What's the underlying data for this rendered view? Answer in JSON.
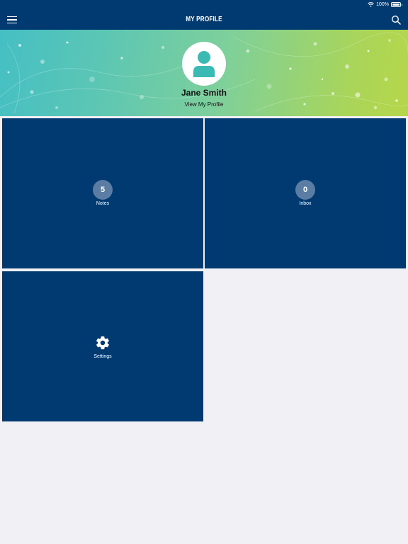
{
  "status_bar": {
    "battery_text": "100%"
  },
  "nav": {
    "title": "MY PROFILE"
  },
  "profile": {
    "name": "Jane Smith",
    "view_link": "View My Profile"
  },
  "tiles": [
    {
      "count": "5",
      "label": "Notes"
    },
    {
      "count": "0",
      "label": "Inbox"
    },
    {
      "label": "Settings"
    }
  ],
  "colors": {
    "primary": "#003a70",
    "badge": "#5b7ca3",
    "avatar_icon": "#3bb9b3",
    "background": "#f0f0f5"
  },
  "icons": [
    "wifi-icon",
    "battery-icon",
    "menu-icon",
    "search-icon",
    "user-icon",
    "gear-icon"
  ]
}
